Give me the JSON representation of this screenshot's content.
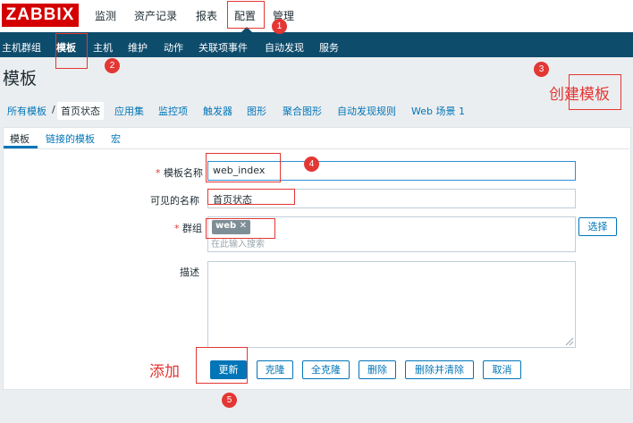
{
  "logo": "ZABBIX",
  "top_menu": [
    "监测",
    "资产记录",
    "报表",
    "配置",
    "管理"
  ],
  "sub_menu": [
    "主机群组",
    "模板",
    "主机",
    "维护",
    "动作",
    "关联项事件",
    "自动发现",
    "服务"
  ],
  "page_title": "模板",
  "breadcrumb": {
    "all_templates": "所有模板",
    "separator": "/",
    "current": "首页状态",
    "links": [
      "应用集",
      "监控项",
      "触发器",
      "图形",
      "聚合图形",
      "自动发现规则",
      "Web 场景 1"
    ]
  },
  "tabs": [
    "模板",
    "链接的模板",
    "宏"
  ],
  "form": {
    "required_mark": "*",
    "template_name_label": "模板名称",
    "template_name_value": "web_index",
    "visible_name_label": "可见的名称",
    "visible_name_value": "首页状态",
    "groups_label": "群组",
    "group_chip": "web",
    "group_chip_remove": "✕",
    "group_search_placeholder": "在此输入搜索",
    "select_button": "选择",
    "description_label": "描述",
    "description_value": ""
  },
  "buttons": [
    "更新",
    "克隆",
    "全克隆",
    "删除",
    "删除并清除",
    "取消"
  ],
  "annotations": {
    "numbers": [
      "1",
      "2",
      "3",
      "4",
      "5"
    ],
    "create_template": "创建模板",
    "add": "添加"
  },
  "colors": {
    "brand_red": "#d40000",
    "nav_blue": "#0e4c6c",
    "link_blue": "#0275b8",
    "annotation_red": "#e33734"
  }
}
